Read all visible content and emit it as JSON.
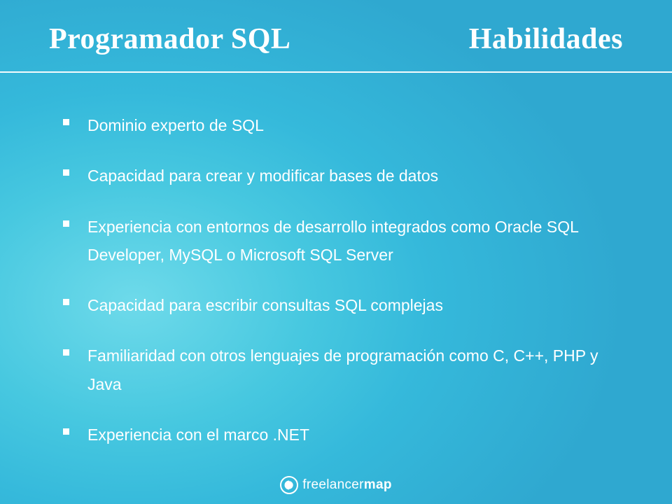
{
  "header": {
    "title_left": "Programador SQL",
    "title_right": "Habilidades"
  },
  "bullets": [
    "Dominio experto de SQL",
    "Capacidad para crear y modificar bases de datos",
    "Experiencia con entornos de desarrollo integrados como Oracle SQL Developer, MySQL o Microsoft SQL Server",
    "Capacidad para escribir consultas SQL complejas",
    "Familiaridad con otros lenguajes de programación como C, C++, PHP y Java",
    "Experiencia con el marco .NET"
  ],
  "footer": {
    "brand_light": "freelancer",
    "brand_bold": "map"
  }
}
